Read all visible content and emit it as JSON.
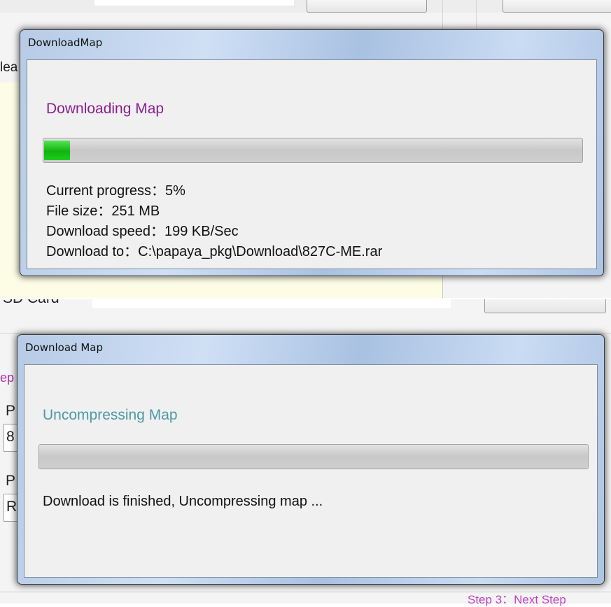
{
  "background_top": {
    "partial_label": "lea"
  },
  "background_bottom": {
    "partial_header": "SD Card",
    "partial_label_1": "ep",
    "partial_label_2": "P",
    "partial_label_3": "8",
    "partial_label_4": "P",
    "partial_label_5": "R"
  },
  "dialog_download": {
    "title": "DownloadMap",
    "heading": "Downloading Map",
    "progress_percent": 5,
    "lines": [
      "Current progress：5%",
      "File size：251 MB",
      "Download speed：199 KB/Sec",
      "Download to：C:\\papaya_pkg\\Download\\827C-ME.rar"
    ]
  },
  "dialog_uncompress": {
    "title": "Download Map",
    "heading": "Uncompressing Map",
    "progress_percent": 0,
    "status": "Download is finished, Uncompressing map ..."
  },
  "footer": {
    "step_label": "Step 3：Next Step"
  },
  "colors": {
    "downloading_heading": "#8a1f8f",
    "uncompressing_heading": "#4b9aa5",
    "step_link": "#c040c0",
    "progress_green": "#1ab51a"
  }
}
